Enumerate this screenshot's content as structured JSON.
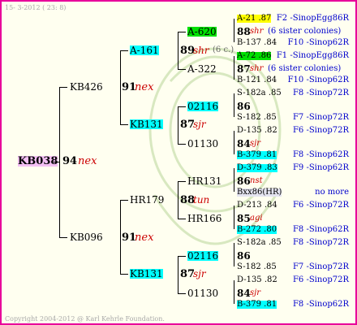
{
  "header": "15- 3-2012 ( 23: 8)",
  "footer": "Copyright 2004-2012 @ Karl Kehrle Foundation.",
  "root": {
    "id": "KB038",
    "num": "94",
    "suffix": "nex"
  },
  "g1": [
    {
      "id": "KB426",
      "num": "91",
      "suffix": "nex"
    },
    {
      "id": "KB096",
      "num": "91",
      "suffix": "nex"
    }
  ],
  "g2": [
    {
      "id": "A-161",
      "num": "89",
      "suffix": "shr",
      "note": "(6 c.)"
    },
    {
      "id": "KB131",
      "num": "87",
      "suffix": "sjr"
    },
    {
      "id": "HR179",
      "num": "88",
      "suffix": "tun"
    },
    {
      "id": "KB131",
      "num": "87",
      "suffix": "sjr"
    }
  ],
  "g3": [
    {
      "id": "A-620"
    },
    {
      "id": "A-322"
    },
    {
      "id": "02116"
    },
    {
      "id": "01130"
    },
    {
      "id": "HR131"
    },
    {
      "id": "HR166"
    },
    {
      "id": "02116"
    },
    {
      "id": "01130"
    }
  ],
  "g4": [
    {
      "top": "A-21 .87",
      "mid_num": "88",
      "mid_suffix": "shr",
      "mid_note": "(6 sister colonies)",
      "bot": "B-137 .84"
    },
    {
      "top": "A-72 .86",
      "mid_num": "87",
      "mid_suffix": "shr",
      "mid_note": "(6 sister colonies)",
      "bot": "B-121 .84"
    },
    {
      "top": "S-182a .85",
      "mid_num": "86",
      "mid_suffix": "",
      "mid_note": "",
      "bot": "S-182 .85"
    },
    {
      "top": "D-135 .82",
      "mid_num": "84",
      "mid_suffix": "sjr",
      "mid_note": "",
      "bot": "B-379 .81"
    },
    {
      "top": "D-379 .83",
      "mid_num": "86",
      "mid_suffix": "nst",
      "mid_note": "",
      "bot": "Bxx86(HR)"
    },
    {
      "top": "D-213 .84",
      "mid_num": "85",
      "mid_suffix": "agi",
      "mid_note": "",
      "bot": "B-272 .80"
    },
    {
      "top": "S-182a .85",
      "mid_num": "86",
      "mid_suffix": "",
      "mid_note": "",
      "bot": "S-182 .85"
    },
    {
      "top": "D-135 .82",
      "mid_num": "84",
      "mid_suffix": "sjr",
      "mid_note": "",
      "bot": "B-379 .81"
    }
  ],
  "right": [
    "F2 -SinopEgg86R",
    "F10 -Sinop62R",
    "F1 -SinopEgg86R",
    "F10 -Sinop62R",
    "F8 -Sinop72R",
    "F7 -Sinop72R",
    "F6 -Sinop72R",
    "F8 -Sinop62R",
    "F9 -Sinop62R",
    "no more",
    "F6 -Sinop72R",
    "F8 -Sinop62R",
    "F8 -Sinop72R",
    "F7 -Sinop72R",
    "F6 -Sinop72R",
    "F8 -Sinop62R"
  ]
}
